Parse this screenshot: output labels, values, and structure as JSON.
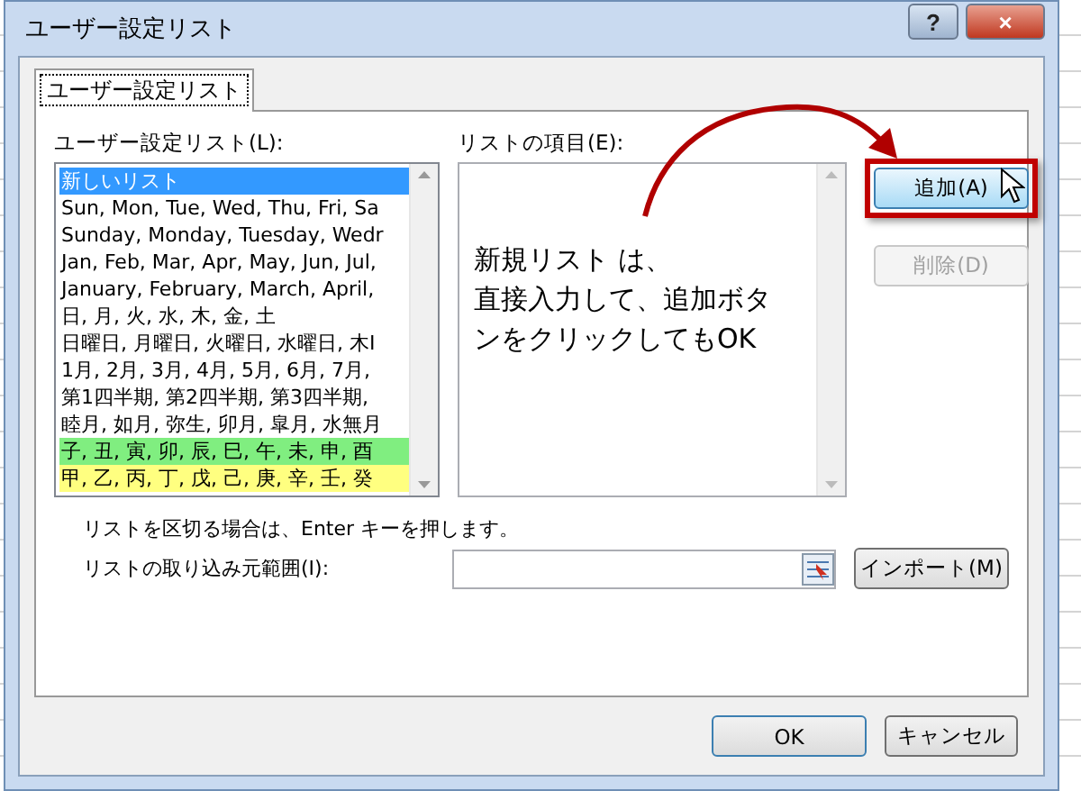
{
  "window": {
    "title": "ユーザー設定リスト",
    "help_button": "?",
    "close_button": "×"
  },
  "tabs": [
    {
      "label": "ユーザー設定リスト",
      "selected": true
    }
  ],
  "custom_lists": {
    "label": "ユーザー設定リスト(L):",
    "items": [
      {
        "text": "新しいリスト",
        "selected": true
      },
      {
        "text": "Sun, Mon, Tue, Wed, Thu, Fri, Sa",
        "selected": false
      },
      {
        "text": "Sunday, Monday, Tuesday, Wedr",
        "selected": false
      },
      {
        "text": "Jan, Feb, Mar, Apr, May, Jun, Jul,",
        "selected": false
      },
      {
        "text": "January, February, March, April,",
        "selected": false
      },
      {
        "text": "日, 月, 火, 水, 木, 金, 土",
        "selected": false
      },
      {
        "text": "日曜日, 月曜日, 火曜日, 水曜日, 木I",
        "selected": false
      },
      {
        "text": "1月, 2月, 3月, 4月, 5月, 6月, 7月,",
        "selected": false
      },
      {
        "text": "第1四半期, 第2四半期, 第3四半期,",
        "selected": false
      },
      {
        "text": "睦月, 如月, 弥生, 卯月, 皐月, 水無月",
        "selected": false
      },
      {
        "text": "子, 丑, 寅, 卯, 辰, 巳, 午, 未, 申, 酉",
        "selected": false,
        "color": "#80ee80"
      },
      {
        "text": "甲, 乙, 丙, 丁, 戊, 己, 庚, 辛, 壬, 癸",
        "selected": false,
        "color": "#ffff80"
      }
    ]
  },
  "list_entries": {
    "label": "リストの項目(E):",
    "callout": [
      "新規リスト は、",
      "直接入力して、追加ボタ",
      "ンをクリックしてもOK"
    ]
  },
  "buttons": [
    {
      "label": "追加(A)",
      "disabled": false,
      "highlighted": true
    },
    {
      "label": "削除(D)",
      "disabled": true,
      "highlighted": false
    }
  ],
  "hint": "リストを区切る場合は、Enter キーを押します。",
  "import": {
    "label": "リストの取り込み元範囲(I):",
    "button": "インポート(M)"
  },
  "footer_buttons": [
    "OK",
    "キャンセル"
  ]
}
